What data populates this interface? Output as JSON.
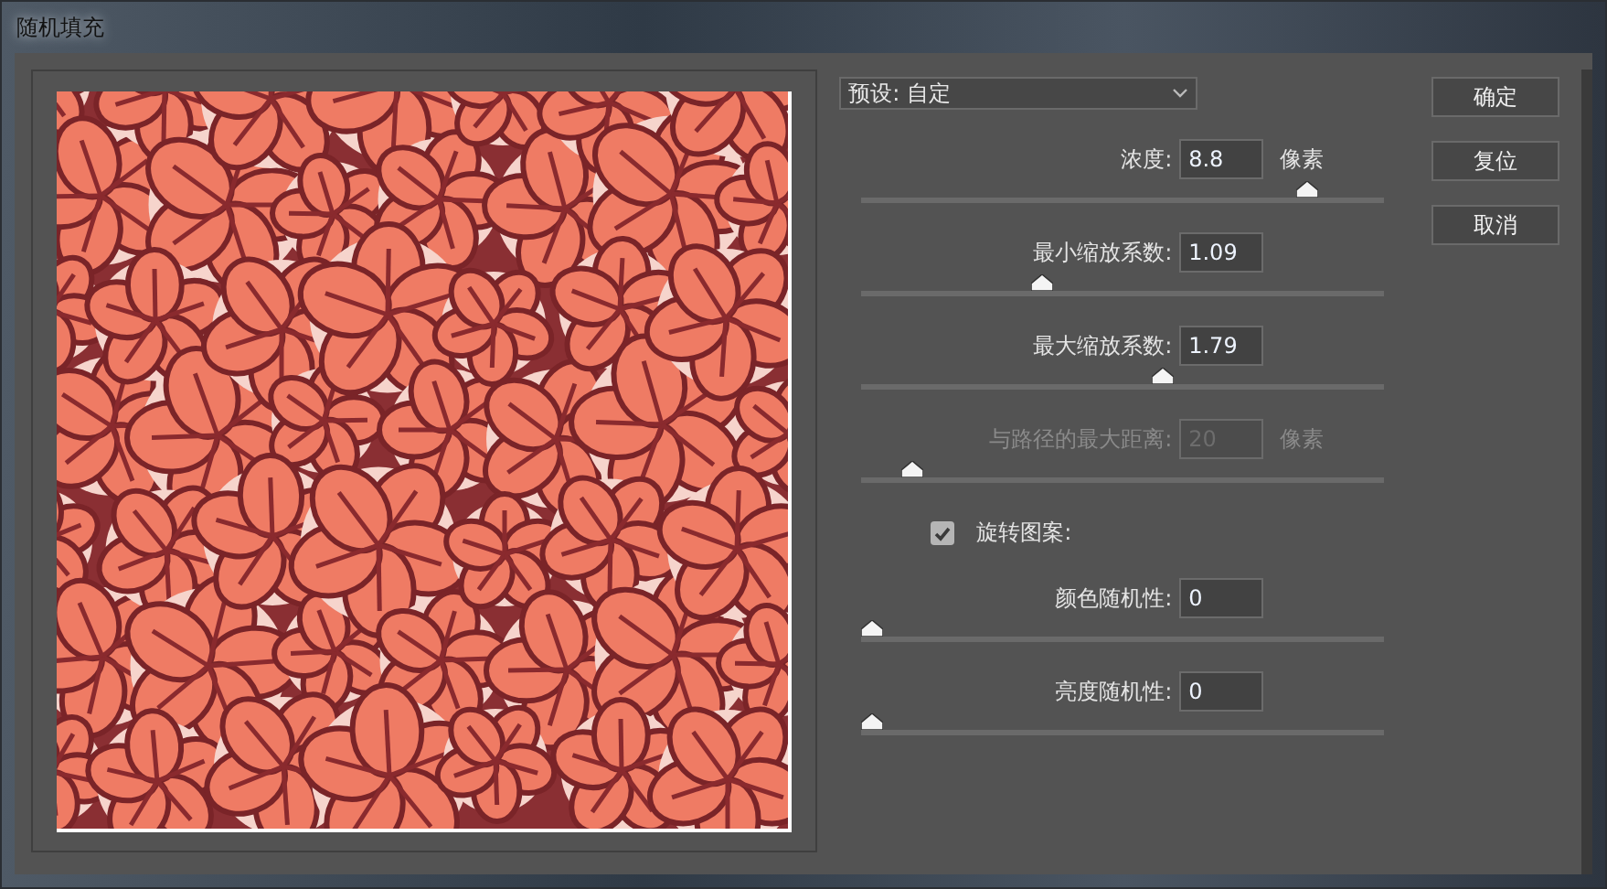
{
  "window": {
    "title": "随机填充"
  },
  "preset": {
    "label": "预设:",
    "value": "自定"
  },
  "settings": [
    {
      "kind": "field",
      "label": "浓度:",
      "value": "8.8",
      "unit": "像素",
      "level": 0.87,
      "disabled": false
    },
    {
      "kind": "field",
      "label": "最小缩放系数:",
      "value": "1.09",
      "level": 0.34,
      "disabled": false
    },
    {
      "kind": "field",
      "label": "最大缩放系数:",
      "value": "1.79",
      "level": 0.58,
      "disabled": false
    },
    {
      "kind": "field",
      "label": "与路径的最大距离:",
      "value": "20",
      "unit": "像素",
      "level": 0.08,
      "disabled": true
    },
    {
      "kind": "checkbox",
      "label": "旋转图案:",
      "checked": true
    },
    {
      "kind": "field",
      "label": "颜色随机性:",
      "value": "0",
      "level": 0,
      "disabled": false
    },
    {
      "kind": "field",
      "label": "亮度随机性:",
      "value": "0",
      "level": 0,
      "disabled": false
    }
  ],
  "buttons": [
    "确定",
    "复位",
    "取消"
  ]
}
